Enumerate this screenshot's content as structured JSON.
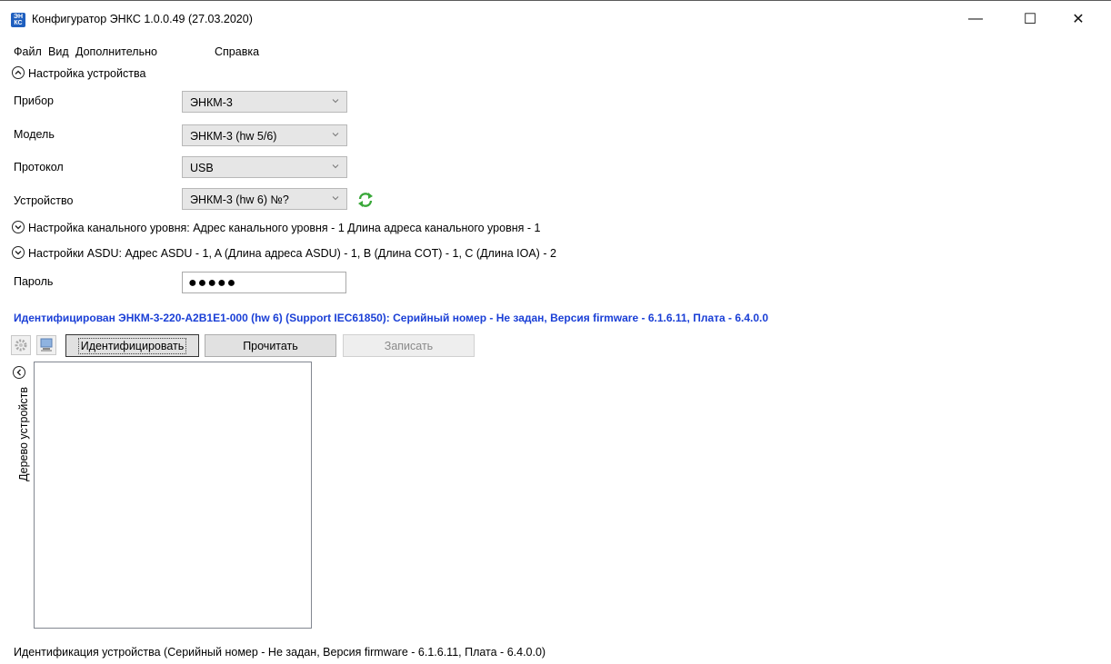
{
  "window": {
    "title": "Конфигуратор ЭНКС 1.0.0.49 (27.03.2020)",
    "app_icon_text": "ЭН КС",
    "minimize": "—",
    "maximize": "☐",
    "close": "✕"
  },
  "menu": {
    "items": [
      "Файл",
      "Вид",
      "Дополнительно",
      "Справка"
    ]
  },
  "device_settings": {
    "expander_label": "Настройка устройства",
    "rows": [
      {
        "label": "Прибор",
        "value": "ЭНКМ-3"
      },
      {
        "label": "Модель",
        "value": "ЭНКМ-3 (hw 5/6)"
      },
      {
        "label": "Протокол",
        "value": "USB"
      },
      {
        "label": "Устройство",
        "value": "ЭНКМ-3 (hw 6) №?"
      }
    ]
  },
  "channel_level": {
    "expander_label": "Настройка канального уровня: Адрес канального уровня - 1 Длина адреса канального уровня  - 1"
  },
  "asdu": {
    "expander_label": "Настройки ASDU: Адрес ASDU - 1, A (Длина адреса ASDU) - 1, B (Длина COT) - 1, C (Длина IOA) - 2"
  },
  "password": {
    "label": "Пароль",
    "value": "●●●●●"
  },
  "identified_line": "Идентифицирован ЭНКМ-3-220-A2B1E1-000 (hw 6) (Support IEC61850):   Серийный номер - Не задан, Версия firmware - 6.1.6.11, Плата - 6.4.0.0",
  "toolbar": {
    "identify_label": "Идентифицировать",
    "read_label": "Прочитать",
    "write_label": "Записать"
  },
  "tree": {
    "side_label": "Дерево устройств"
  },
  "status_bar": "Идентификация устройства (Серийный номер - Не задан, Версия firmware - 6.1.6.11, Плата - 6.4.0.0)",
  "colors": {
    "identified_text": "#1a3fd6",
    "refresh_icon": "#3aa83a",
    "app_icon": "#1f5fbf"
  }
}
